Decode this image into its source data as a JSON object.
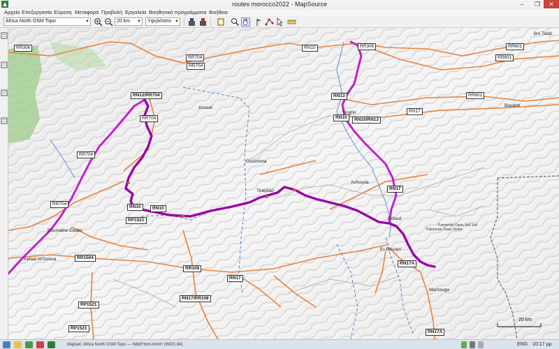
{
  "window": {
    "title": "routes morocco2022 - MapSource",
    "min": "‒",
    "max": "❐",
    "close": "✕"
  },
  "menu": [
    "Αρχείο",
    "Επεξεργασία",
    "Εύρεση",
    "Μεταφορά",
    "Προβολή",
    "Εργαλεία",
    "Βοηθητικά προγράμματα",
    "Βοήθεια"
  ],
  "toolbar": {
    "map_product": "Africa North OSM Topo",
    "zoom_level": "20 km",
    "detail_level": "Υψηλότατο"
  },
  "map": {
    "road_labels": [
      {
        "text": "RR306"
      },
      {
        "text": "RR704"
      },
      {
        "text": "RR704"
      },
      {
        "text": "RR704"
      },
      {
        "text": "RN12/RR704"
      },
      {
        "text": "RR704"
      },
      {
        "text": "RR704"
      },
      {
        "text": "RN10"
      },
      {
        "text": "RR306"
      },
      {
        "text": "RR601"
      },
      {
        "text": "RR601"
      },
      {
        "text": "RR601"
      },
      {
        "text": "RN13"
      },
      {
        "text": "RN10"
      },
      {
        "text": "RN10/RN13"
      },
      {
        "text": "RN17"
      },
      {
        "text": "RN17"
      },
      {
        "text": "RN10"
      },
      {
        "text": "RN10"
      },
      {
        "text": "RP1521"
      },
      {
        "text": "RR1504"
      },
      {
        "text": "RR108"
      },
      {
        "text": "RN17"
      },
      {
        "text": "RN17/RR108"
      },
      {
        "text": "RP1521"
      },
      {
        "text": "RP1521"
      },
      {
        "text": "RN17A"
      },
      {
        "text": "RN17A"
      }
    ],
    "place_labels": [
      {
        "text": "Assoul"
      },
      {
        "text": "Erfoud"
      },
      {
        "text": "Boudob"
      },
      {
        "text": "Tinghir"
      },
      {
        "text": "Goulmima"
      },
      {
        "text": "Tinejdad"
      },
      {
        "text": "Achouria"
      },
      {
        "text": "Kelaat M'Gouna"
      },
      {
        "text": "Boumalne Dadès"
      },
      {
        "text": "Er-Rissani"
      },
      {
        "text": "Merzouga"
      },
      {
        "text": "Bni Tadjit"
      },
      {
        "text": "Palmeraie Oasis Sell Sell"
      },
      {
        "text": "Palmeraie Oasis Touka"
      }
    ],
    "scale_label": "20 km"
  },
  "statusbar": {
    "text": "Mapset: Africa North OSM Topo — hddd°mm.mmm' (WGS 84)"
  },
  "tray": {
    "language": "ENG",
    "clock": "10:17 μμ"
  },
  "colors": {
    "route": "#c21fd0",
    "highlight_route": "#9a00a6",
    "border": "#3a78c9",
    "road": "#e8823a"
  },
  "icons": {
    "app": "mapsource-icon",
    "zoom_in": "zoom-in-icon",
    "zoom_out": "zoom-out-icon",
    "hand": "hand-pan-icon"
  }
}
